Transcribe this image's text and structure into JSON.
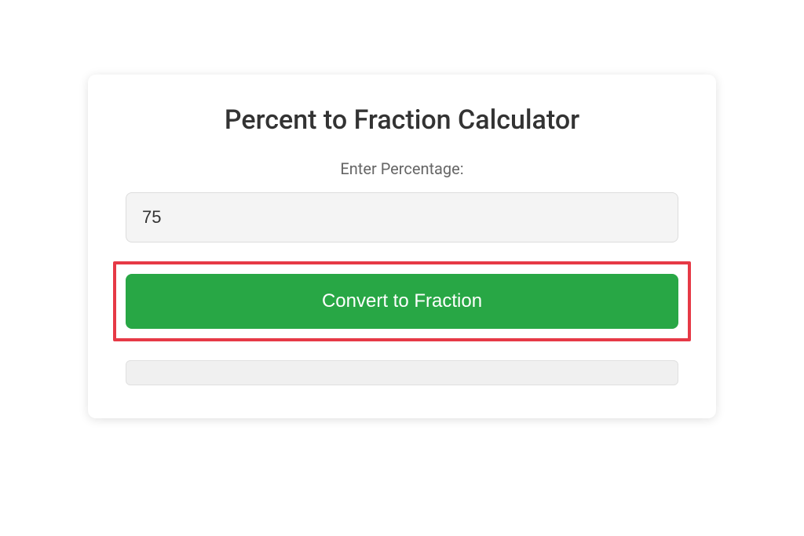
{
  "calculator": {
    "title": "Percent to Fraction Calculator",
    "input_label": "Enter Percentage:",
    "input_value": "75",
    "convert_button_label": "Convert to Fraction",
    "result_value": ""
  }
}
